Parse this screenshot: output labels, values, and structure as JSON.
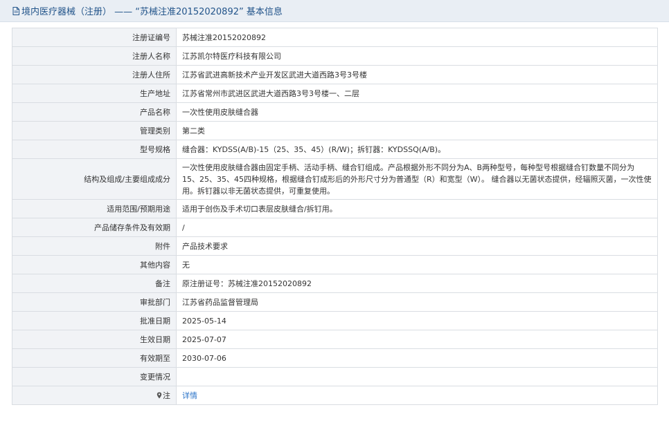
{
  "header": {
    "icon": "document-icon",
    "title": "境内医疗器械（注册） —— “苏械注准20152020892” 基本信息"
  },
  "rows": [
    {
      "label": "注册证编号",
      "value": "苏械注准20152020892"
    },
    {
      "label": "注册人名称",
      "value": "江苏凯尔特医疗科技有限公司"
    },
    {
      "label": "注册人住所",
      "value": "江苏省武进高新技术产业开发区武进大道西路3号3号楼"
    },
    {
      "label": "生产地址",
      "value": "江苏省常州市武进区武进大道西路3号3号楼一、二层"
    },
    {
      "label": "产品名称",
      "value": "一次性使用皮肤缝合器"
    },
    {
      "label": "管理类别",
      "value": "第二类"
    },
    {
      "label": "型号规格",
      "value": "缝合器：KYDSS(A/B)-15（25、35、45）(R/W)；拆钉器：KYDSSQ(A/B)。"
    },
    {
      "label": "结构及组成/主要组成成分",
      "value": "一次性使用皮肤缝合器由固定手柄、活动手柄、缝合钉组成。产品根据外形不同分为A、B两种型号，每种型号根据缝合钉数量不同分为15、25、35、45四种规格，根据缝合钉成形后的外形尺寸分为普通型（R）和宽型（W）。 缝合器以无菌状态提供，经辐照灭菌，一次性使用。拆钉器以非无菌状态提供，可重复使用。"
    },
    {
      "label": "适用范围/预期用途",
      "value": "适用于创伤及手术切口表层皮肤缝合/拆钉用。"
    },
    {
      "label": "产品储存条件及有效期",
      "value": "/"
    },
    {
      "label": "附件",
      "value": "产品技术要求"
    },
    {
      "label": "其他内容",
      "value": "无"
    },
    {
      "label": "备注",
      "value": "原注册证号：苏械注准20152020892"
    },
    {
      "label": "审批部门",
      "value": "江苏省药品监督管理局"
    },
    {
      "label": "批准日期",
      "value": "2025-05-14"
    },
    {
      "label": "生效日期",
      "value": "2025-07-07"
    },
    {
      "label": "有效期至",
      "value": "2030-07-06"
    },
    {
      "label": "变更情况",
      "value": ""
    }
  ],
  "note": {
    "icon": "pin-icon",
    "label": "注",
    "link_text": "详情"
  },
  "colors": {
    "header_bg": "#e9eef4",
    "title": "#22548a",
    "label_bg": "#f1f3f6",
    "border": "#d9dde2",
    "link": "#2a73c8"
  }
}
